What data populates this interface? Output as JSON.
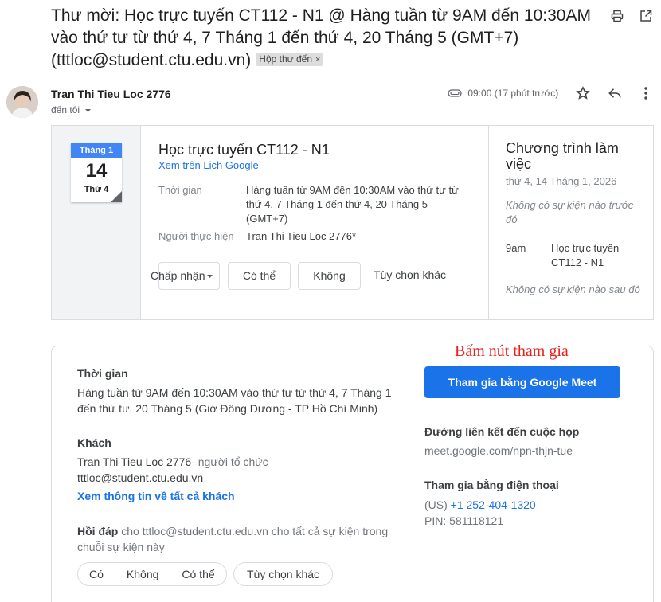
{
  "email": {
    "subject": "Thư mời: Học trực tuyến CT112 - N1 @ Hàng tuần từ 9AM đến 10:30AM vào thứ tư từ thứ 4, 7 Tháng 1 đến thứ 4, 20 Tháng 5 (GMT+7) (tttloc@student.ctu.edu.vn)",
    "label": "Hộp thư đến",
    "label_remove": "×",
    "sender_name": "Tran Thi Tieu Loc 2776",
    "recipient": "đến tôi",
    "time": "09:00 (17 phút trước)",
    "icons": [
      "print-icon",
      "open-in-new-window-icon",
      "attachment-icon",
      "star-icon",
      "reply-icon",
      "more-vert-icon",
      "chevron-down-icon"
    ]
  },
  "invite": {
    "badge": {
      "month": "Tháng 1",
      "day": "14",
      "weekday": "Thứ 4"
    },
    "title": "Học trực tuyến CT112 - N1",
    "calendar_link": "Xem trên Lịch Google",
    "time_label": "Thời gian",
    "time_value": "Hàng tuần từ 9AM đến 10:30AM vào thứ tư từ thứ 4, 7 Tháng 1 đến thứ 4, 20 Tháng 5 (GMT+7)",
    "organizer_label": "Người thực hiện",
    "organizer_value": "Tran Thi Tieu Loc 2776*",
    "rsvp": {
      "accept": "Chấp nhận",
      "maybe": "Có thể",
      "decline": "Không",
      "more": "Tùy chọn khác"
    }
  },
  "agenda": {
    "title": "Chương trình làm việc",
    "date": "thứ 4, 14 Tháng 1, 2026",
    "empty_before": "Không có sự kiện nào trước đó",
    "item_time": "9am",
    "item_title": "Học trực tuyến CT112 - N1",
    "empty_after": "Không có sự kiện nào sau đó"
  },
  "details": {
    "time_title": "Thời gian",
    "time_text": "Hàng tuần từ 9AM đến 10:30AM vào thứ tư từ thứ 4, 7 Tháng 1 đến thứ tư, 20 Tháng 5 (Giờ Đông Dương - TP Hồ Chí Minh)",
    "guests_title": "Khách",
    "guest_name": "Tran Thi Tieu Loc 2776",
    "guest_role": "- người tổ chức",
    "guest_email": "tttloc@student.ctu.edu.vn",
    "view_all_guests": "Xem thông tin về tất cả khách",
    "reply_title": "Hồi đáp",
    "reply_text": "cho tttloc@student.ctu.edu.vn cho tất cả sự kiện trong chuỗi sự kiện này",
    "reply_buttons": {
      "yes": "Có",
      "no": "Không",
      "maybe": "Có thể"
    },
    "reply_more": "Tùy chọn khác",
    "join_button": "Tham gia bằng Google Meet",
    "meeting_link_title": "Đường liên kết đến cuộc họp",
    "meeting_link": "meet.google.com/npn-thjn-tue",
    "phone_title": "Tham gia bằng điện thoại",
    "phone_country": "(US)",
    "phone_number": "+1 252-404-1320",
    "pin": "PIN: 581118121"
  },
  "annotation": "Bấm nút tham gia",
  "colors": {
    "accent": "#1a73e8",
    "calendar_blue": "#4285f4",
    "annotation_red": "#e8201b"
  }
}
